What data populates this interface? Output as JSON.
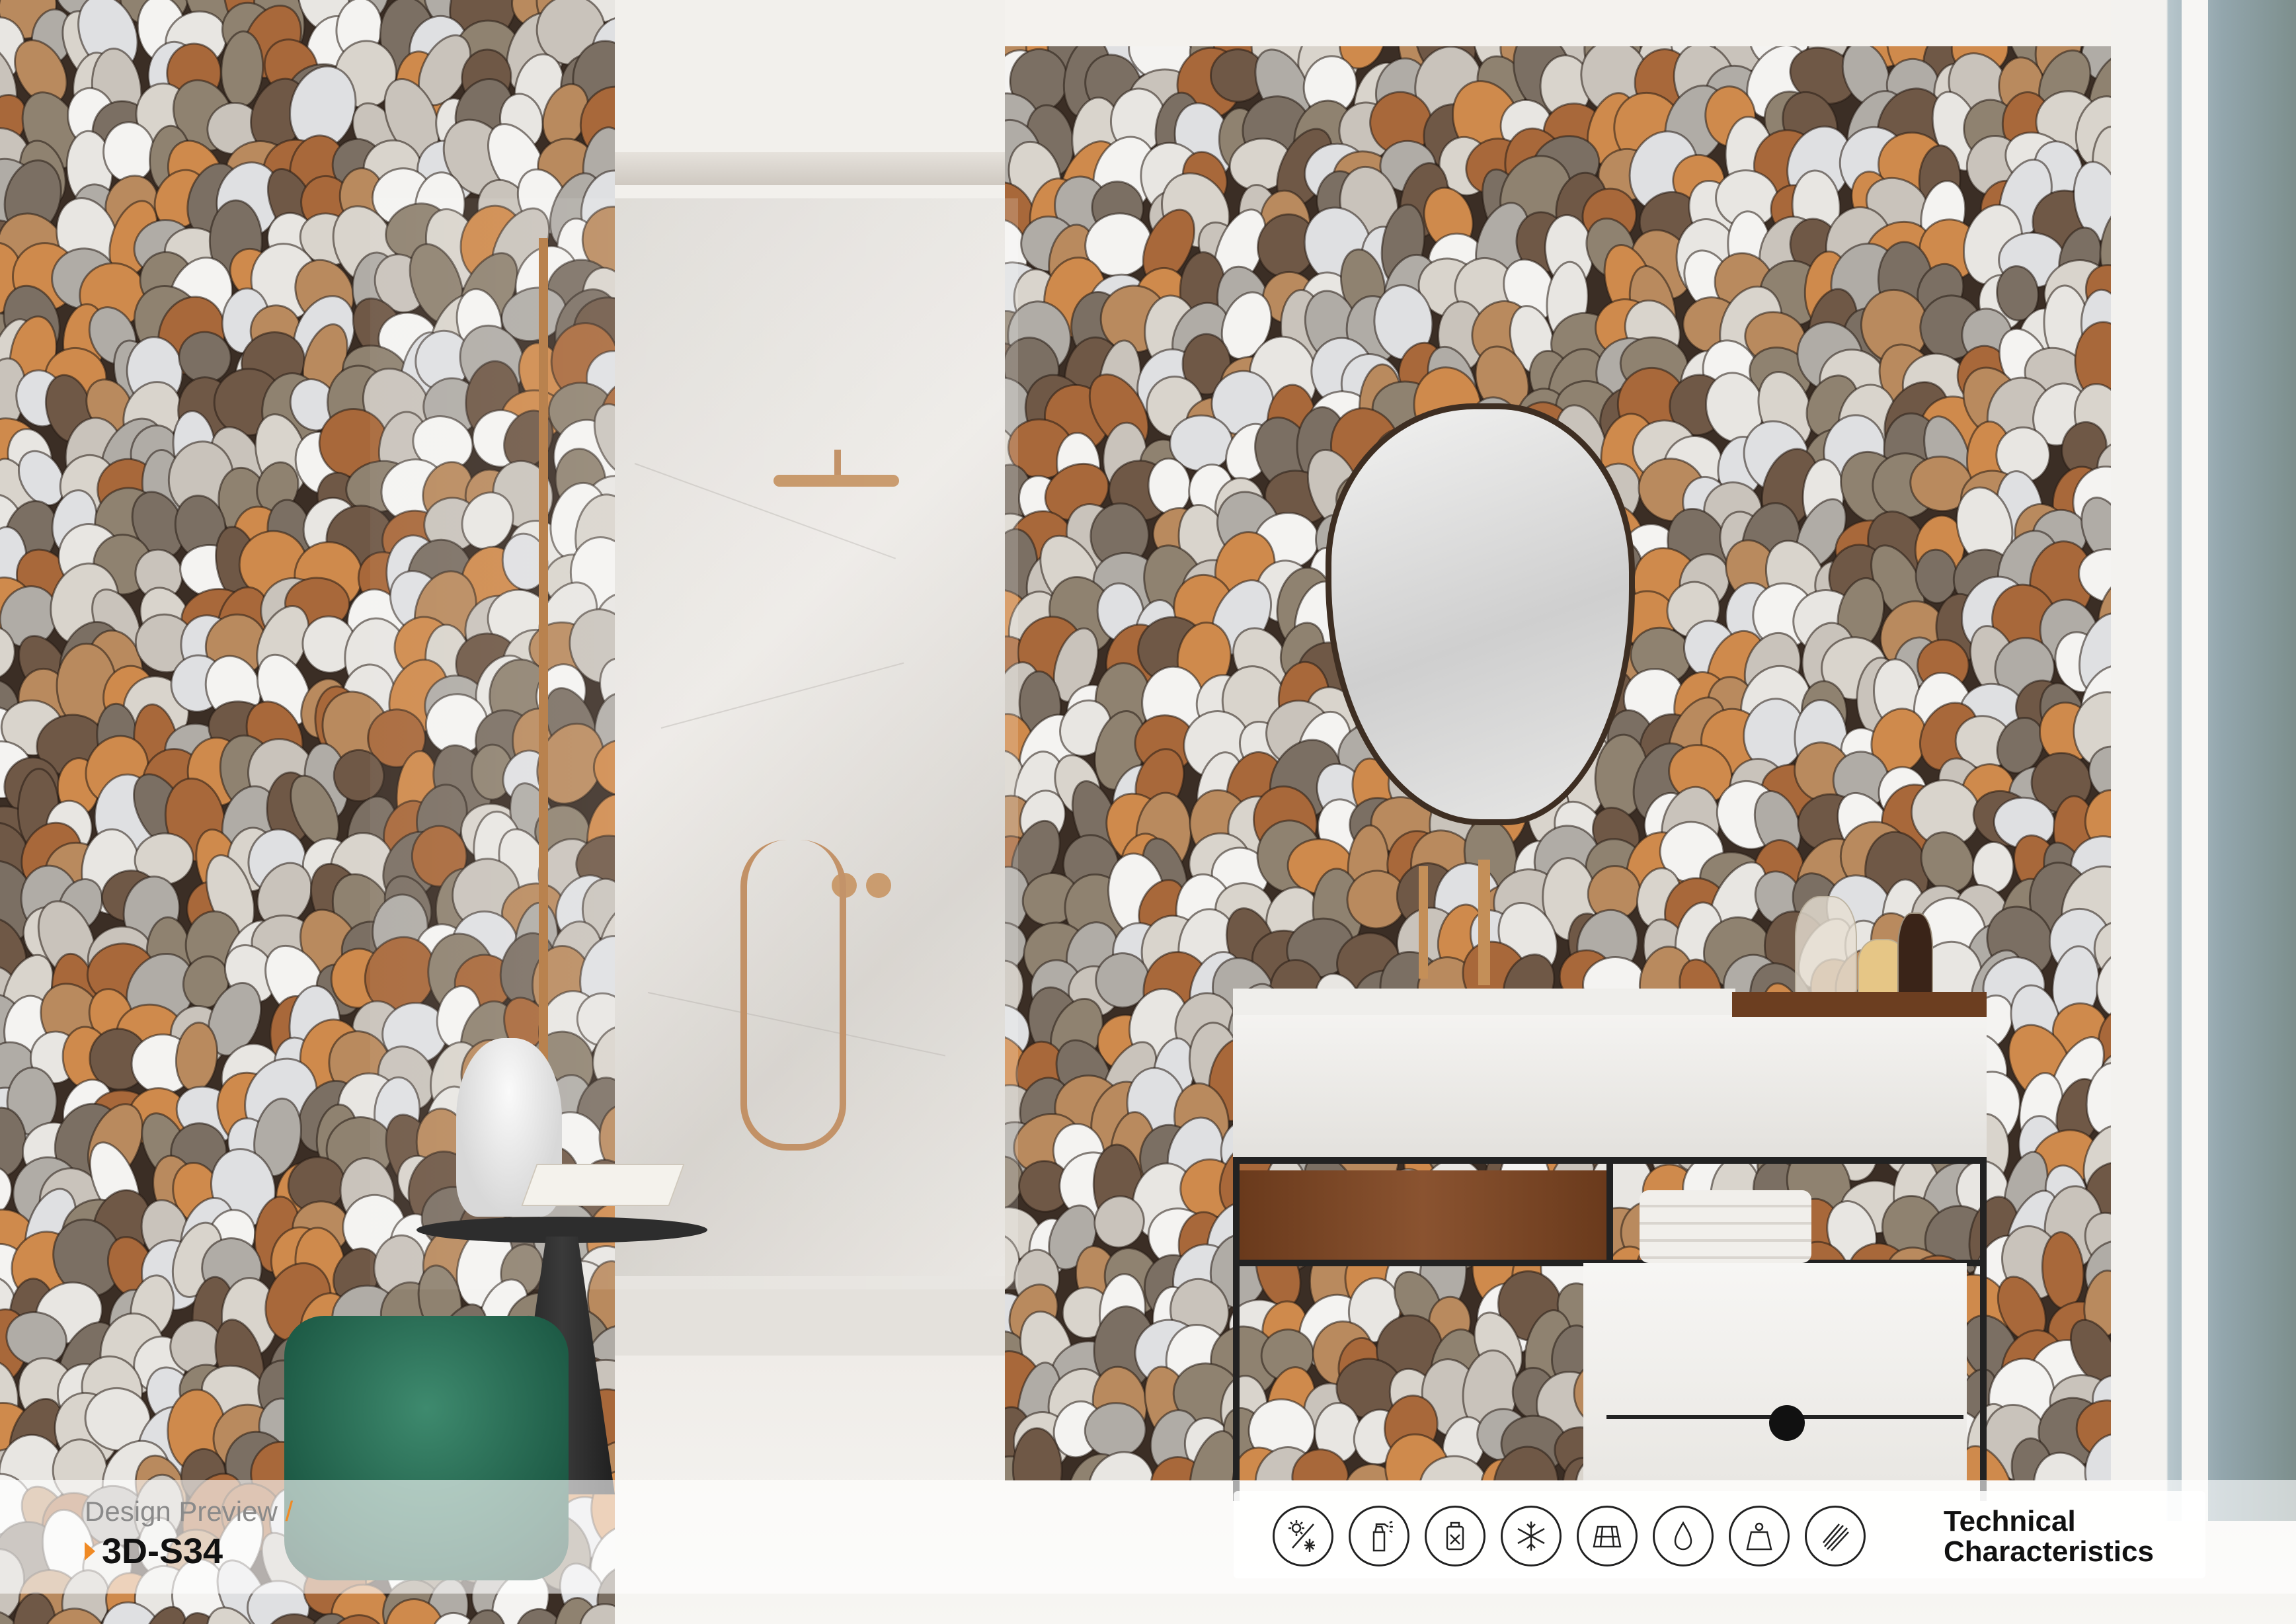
{
  "preview": {
    "label": "Design Preview",
    "separator": "/",
    "code": "3D-S34"
  },
  "technical": {
    "title_line1": "Technical",
    "title_line2": "Characteristics",
    "icons": [
      "sun-snow-icon",
      "spray-bottle-icon",
      "chemical-resistance-icon",
      "frost-resistance-icon",
      "tile-layout-icon",
      "water-drop-icon",
      "weight-icon",
      "scratch-resistance-icon"
    ]
  },
  "colors": {
    "accent": "#f08a24",
    "text": "#111111",
    "muted": "#8a8a8a"
  }
}
